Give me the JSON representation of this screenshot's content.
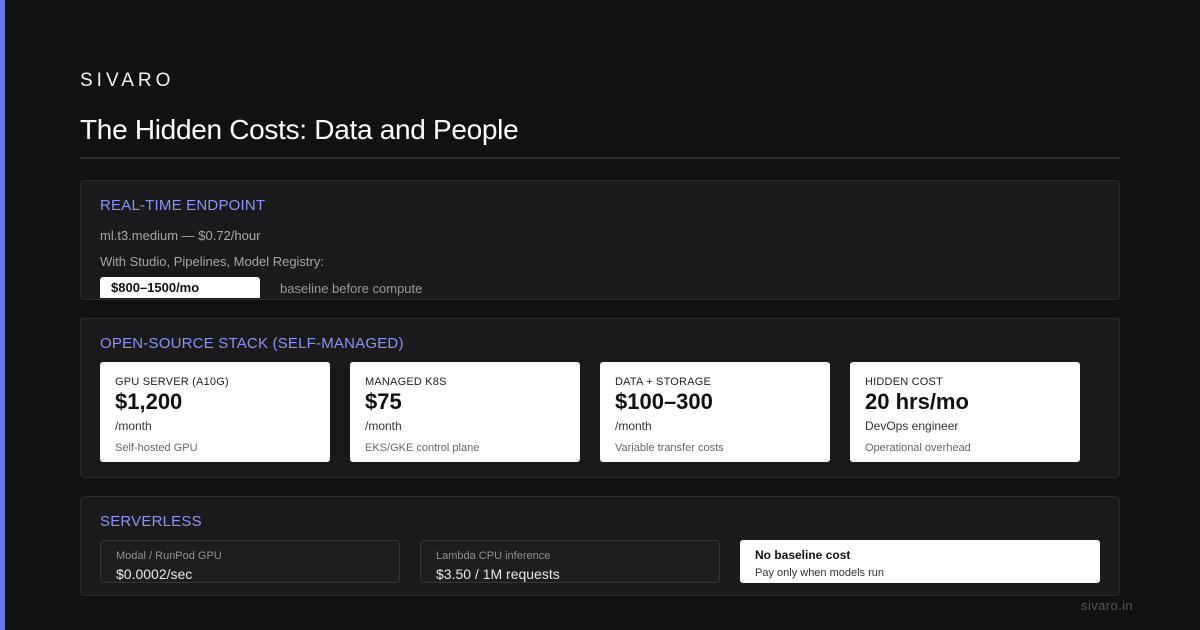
{
  "brand": "SIVARO",
  "title": "The Hidden Costs: Data and People",
  "colors": {
    "accent": "#6a74e8",
    "heading": "#8b93f3",
    "background": "#111112",
    "panel": "#1a1a1c"
  },
  "realtime": {
    "heading": "REAL-TIME ENDPOINT",
    "line1": "ml.t3.medium — $0.72/hour",
    "line2": "With Studio, Pipelines, Model Registry:",
    "pill": "$800–1500/mo",
    "pill_note": "baseline before compute"
  },
  "opensource": {
    "heading": "OPEN-SOURCE STACK (SELF-MANAGED)",
    "cards": [
      {
        "label": "GPU SERVER (A10G)",
        "value": "$1,200",
        "unit": "/month",
        "note": "Self-hosted GPU"
      },
      {
        "label": "MANAGED K8S",
        "value": "$75",
        "unit": "/month",
        "note": "EKS/GKE control plane"
      },
      {
        "label": "DATA + STORAGE",
        "value": "$100–300",
        "unit": "/month",
        "note": "Variable transfer costs"
      },
      {
        "label": "HIDDEN COST",
        "value": "20 hrs/mo",
        "unit": "DevOps engineer",
        "note": "Operational overhead"
      }
    ]
  },
  "serverless": {
    "heading": "SERVERLESS",
    "cards": [
      {
        "label": "Modal / RunPod GPU",
        "value": "$0.0002/sec"
      },
      {
        "label": "Lambda CPU inference",
        "value": "$3.50 / 1M requests"
      }
    ],
    "highlight": {
      "title": "No baseline cost",
      "subtitle": "Pay only when models run"
    }
  },
  "footer": "sivaro.in"
}
